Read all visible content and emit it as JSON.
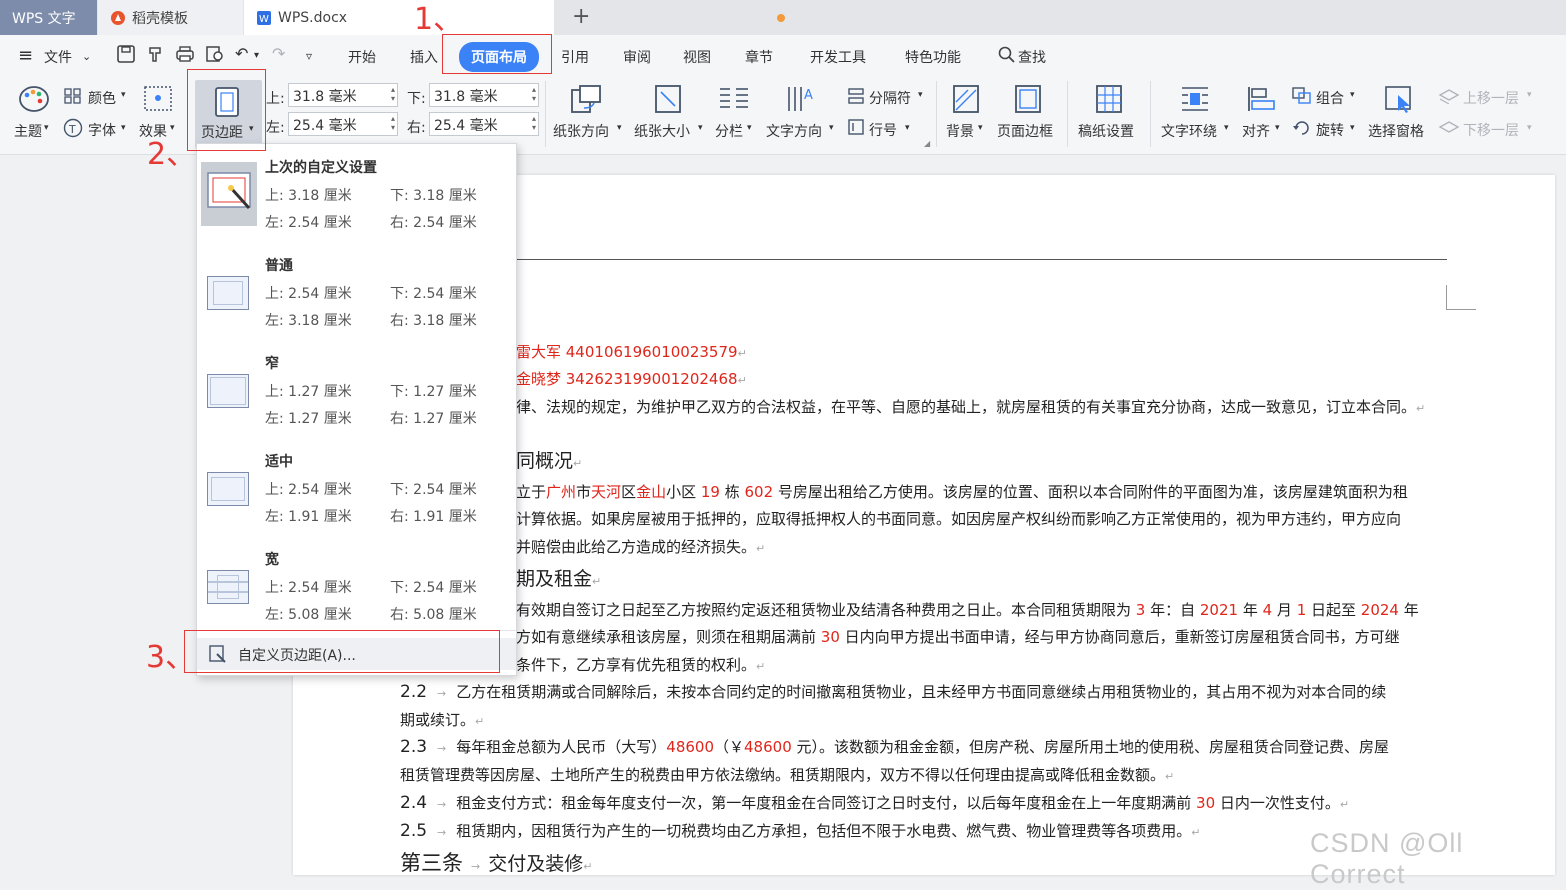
{
  "tabs": {
    "app": "WPS 文字",
    "template": "稻壳模板",
    "doc": "WPS.docx"
  },
  "menu": {
    "file": "文件",
    "start": "开始",
    "insert": "插入",
    "layout": "页面布局",
    "reference": "引用",
    "review": "审阅",
    "view": "视图",
    "section": "章节",
    "devtools": "开发工具",
    "special": "特色功能",
    "search": "查找"
  },
  "ribbon": {
    "theme": "主题",
    "color": "颜色",
    "font": "字体",
    "effect": "效果",
    "margin": "页边距",
    "top_label": "上:",
    "top_value": "31.8 毫米",
    "bottom_label": "下:",
    "bottom_value": "31.8 毫米",
    "left_label": "左:",
    "left_value": "25.4 毫米",
    "right_label": "右:",
    "right_value": "25.4 毫米",
    "orientation": "纸张方向",
    "size": "纸张大小",
    "columns": "分栏",
    "text_direction": "文字方向",
    "separator": "分隔符",
    "line_number": "行号",
    "background": "背景",
    "page_border": "页面边框",
    "draft": "稿纸设置",
    "wrap": "文字环绕",
    "align": "对齐",
    "group": "组合",
    "rotate": "旋转",
    "selection_pane": "选择窗格",
    "bring_forward": "上移一层",
    "send_backward": "下移一层"
  },
  "dropdown": {
    "options": [
      {
        "name": "上次的自定义设置",
        "top": "上: 3.18 厘米",
        "bottom": "下: 3.18 厘米",
        "left": "左: 2.54 厘米",
        "right": "右: 2.54 厘米"
      },
      {
        "name": "普通",
        "top": "上: 2.54 厘米",
        "bottom": "下: 2.54 厘米",
        "left": "左: 3.18 厘米",
        "right": "右: 3.18 厘米"
      },
      {
        "name": "窄",
        "top": "上: 1.27 厘米",
        "bottom": "下: 1.27 厘米",
        "left": "左: 1.27 厘米",
        "right": "右: 1.27 厘米"
      },
      {
        "name": "适中",
        "top": "上: 2.54 厘米",
        "bottom": "下: 2.54 厘米",
        "left": "左: 1.91 厘米",
        "right": "右: 1.91 厘米"
      },
      {
        "name": "宽",
        "top": "上: 2.54 厘米",
        "bottom": "下: 2.54 厘米",
        "left": "左: 5.08 厘米",
        "right": "右: 5.08 厘米"
      }
    ],
    "custom": "自定义页边距(A)..."
  },
  "annotations": {
    "a1": "1、",
    "a2": "2、",
    "a3": "3、"
  },
  "doc": {
    "l1": "雷大军 440106196010023579",
    "l2": "金晓梦 342623199001202468",
    "l3": "律、法规的规定，为维护甲乙双方的合法权益，在平等、自愿的基础上，就房屋租赁的有关事宜充分协商，达成一致意见，订立本合同。",
    "h_overview": "同概况",
    "p1a": "立于",
    "p1city": "广州",
    "p1b": "市",
    "p1dist": "天河",
    "p1c": "区",
    "p1area": "金山",
    "p1d": "小区 ",
    "p1bld": "19",
    "p1e": " 栋 ",
    "p1room": "602",
    "p1f": " 号房屋出租给乙方使用。该房屋的位置、面积以本合同附件的平面图为准，该房屋建筑面积为租",
    "p2": "计算依据。如果房屋被用于抵押的，应取得抵押权人的书面同意。如因房屋产权纠纷而影响乙方正常使用的，视为甲方违约，甲方应向",
    "p3": "并赔偿由此给乙方造成的经济损失。",
    "h_term": "期及租金",
    "t1a": "有效期自签订之日起至乙方按照约定返还租赁物业及结清各种费用之日止。本合同租赁期限为 ",
    "t1y": "3",
    "t1b": " 年：自 ",
    "t1y1": "2021",
    "t1c": " 年 ",
    "t1m": "4",
    "t1d": " 月 ",
    "t1day": "1",
    "t1e": " 日起至 ",
    "t1y2": "2024",
    "t1f": " 年",
    "t2a": "方如有意继续承租该房屋，则须在租期届满前 ",
    "t2n": "30",
    "t2b": " 日内向甲方提出书面申请，经与甲方协商同意后，重新签订房屋租赁合同书，方可继",
    "t3": "条件下，乙方享有优先租赁的权利。",
    "n22": "2.2",
    "s22": "乙方在租赁期满或合同解除后，未按本合同约定的时间撤离租赁物业，且未经甲方书面同意继续占用租赁物业的，其占用不视为对本合同的续",
    "s22b": "期或续订。",
    "n23": "2.3",
    "s23a": "每年租金总额为人民币（大写）",
    "s23amt": "48600",
    "s23b": "（￥",
    "s23amt2": "48600",
    "s23c": " 元）。该数额为租金金额，但房产税、房屋所用土地的使用税、房屋租赁合同登记费、房屋",
    "s23d": "租赁管理费等因房屋、土地所产生的税费由甲方依法缴纳。租赁期限内，双方不得以任何理由提高或降低租金数额。",
    "n24": "2.4",
    "s24a": "租金支付方式：租金每年度支付一次，第一年度租金在合同签订之日时支付，以后每年度租金在上一年度期满前 ",
    "s24n": "30",
    "s24b": " 日内一次性支付。",
    "n25": "2.5",
    "s25": "租赁期内，因租赁行为产生的一切税费均由乙方承担，包括但不限于水电费、燃气费、物业管理费等各项费用。",
    "h3a": "第三条",
    "h3b": "交付及装修"
  },
  "watermark": "CSDN @Oll Correct"
}
